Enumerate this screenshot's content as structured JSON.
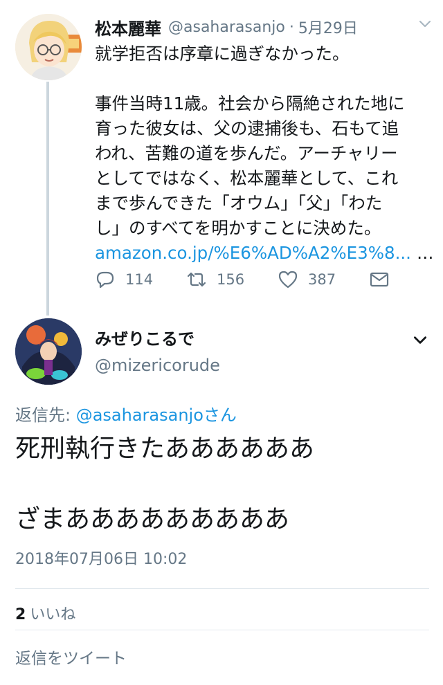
{
  "parent_tweet": {
    "display_name": "松本麗華",
    "handle": "@asaharasanjo",
    "separator": "·",
    "date": "5月29日",
    "body_lines": [
      "就学拒否は序章に過ぎなかった。",
      "",
      "事件当時11歳。社会から隔絶された地に",
      "育った彼女は、父の逮捕後も、石もて追",
      "われ、苦難の道を歩んだ。アーチャリー",
      "としてではなく、松本麗華として、これ",
      "まで歩んできた「オウム」「父」「わた",
      "し」のすべてを明かすことに決めた。"
    ],
    "link_text": "amazon.co.jp/%E6%AD%A2%E3%8...",
    "trailing_ellipsis": "…",
    "actions": {
      "reply_icon": "reply-icon",
      "reply_count": "114",
      "retweet_icon": "retweet-icon",
      "retweet_count": "156",
      "like_icon": "heart-icon",
      "like_count": "387",
      "dm_icon": "envelope-icon"
    }
  },
  "reply_tweet": {
    "display_name": "みぜりこるで",
    "handle": "@mizericorude",
    "reply_to_prefix": "返信先: ",
    "reply_to_mention": "@asaharasanjoさん",
    "body_lines": [
      "死刑執行きたああああああ",
      "",
      "ざまあああああああああ"
    ],
    "timestamp": "2018年07月06日 10:02",
    "like_count": "2",
    "like_label": "いいね",
    "reply_placeholder": "返信をツイート"
  },
  "colors": {
    "link": "#1b95e0",
    "secondary_text": "#657786",
    "primary_text": "#14171a",
    "thread_line": "#ccd6dd",
    "divider": "#e1e8ed"
  }
}
